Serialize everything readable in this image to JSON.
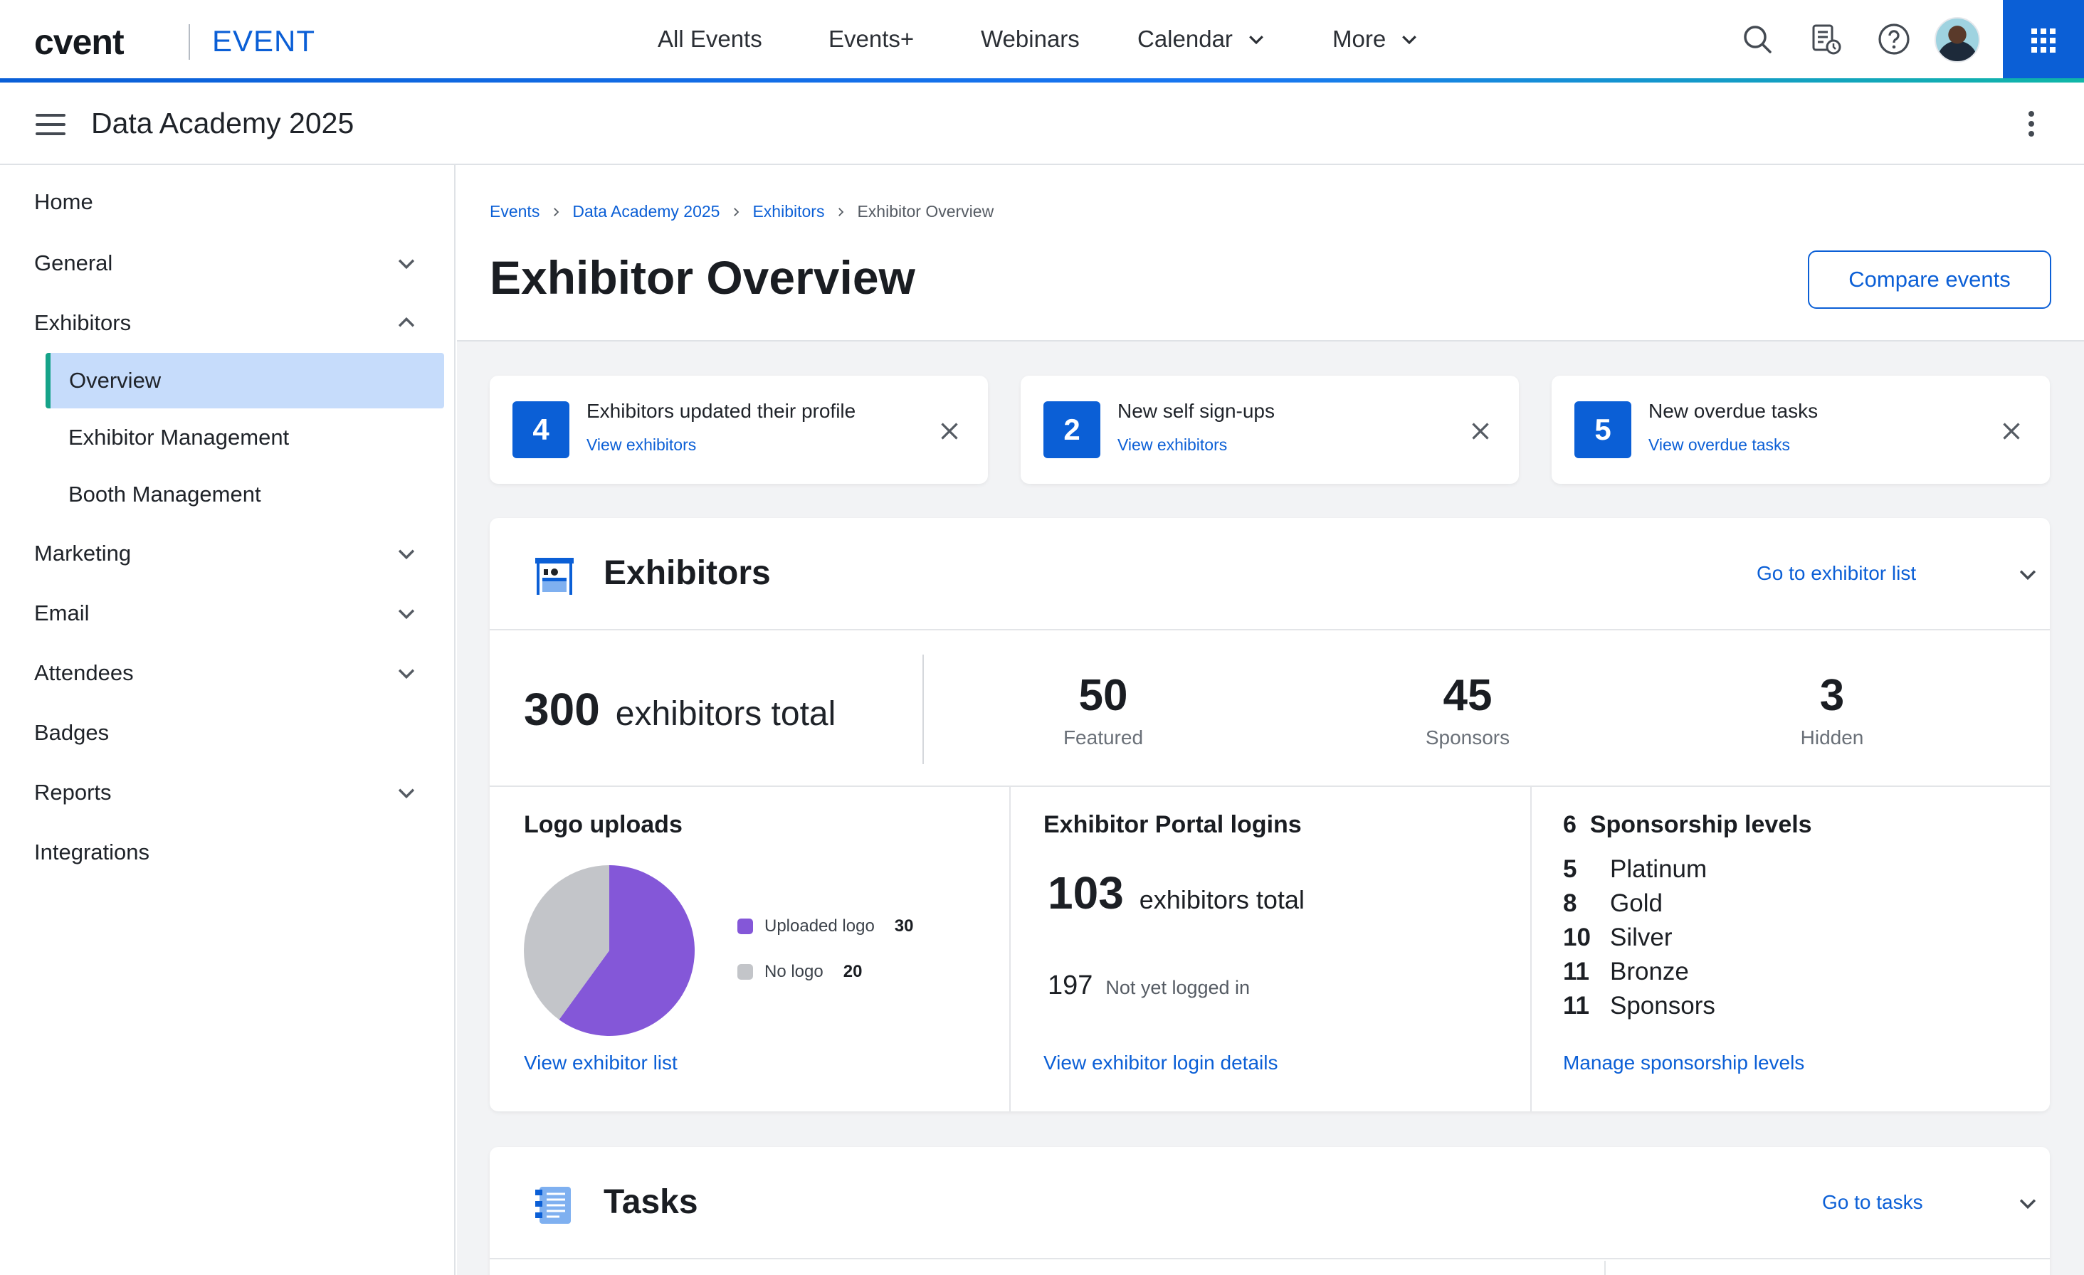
{
  "topbar": {
    "brand": "cvent",
    "product": "EVENT",
    "nav": [
      {
        "label": "All Events"
      },
      {
        "label": "Events+"
      },
      {
        "label": "Webinars"
      },
      {
        "label": "Calendar"
      },
      {
        "label": "More"
      }
    ]
  },
  "subheader": {
    "event_name": "Data Academy 2025"
  },
  "sidebar": {
    "items": [
      {
        "label": "Home"
      },
      {
        "label": "General"
      },
      {
        "label": "Exhibitors"
      },
      {
        "label": "Overview"
      },
      {
        "label": "Exhibitor Management"
      },
      {
        "label": "Booth Management"
      },
      {
        "label": "Marketing"
      },
      {
        "label": "Email"
      },
      {
        "label": "Attendees"
      },
      {
        "label": "Badges"
      },
      {
        "label": "Reports"
      },
      {
        "label": "Integrations"
      }
    ]
  },
  "breadcrumb": [
    "Events",
    "Data Academy 2025",
    "Exhibitors",
    "Exhibitor Overview"
  ],
  "page": {
    "title": "Exhibitor Overview",
    "compare_button": "Compare events"
  },
  "notices": [
    {
      "count": "4",
      "title": "Exhibitors updated their profile",
      "link": "View exhibitors"
    },
    {
      "count": "2",
      "title": "New self sign-ups",
      "link": "View exhibitors"
    },
    {
      "count": "5",
      "title": "New overdue tasks",
      "link": "View overdue tasks"
    }
  ],
  "exhibitors": {
    "title": "Exhibitors",
    "link": "Go to exhibitor list",
    "total": "300",
    "total_label": "exhibitors total",
    "stats": [
      {
        "value": "50",
        "label": "Featured"
      },
      {
        "value": "45",
        "label": "Sponsors"
      },
      {
        "value": "3",
        "label": "Hidden"
      }
    ],
    "logo_uploads": {
      "title": "Logo uploads",
      "legend": [
        {
          "label": "Uploaded logo",
          "value": "30",
          "color": "#8457d8"
        },
        {
          "label": "No logo",
          "value": "20",
          "color": "#c3c5c9"
        }
      ],
      "link": "View exhibitor list"
    },
    "portal_logins": {
      "title": "Exhibitor Portal logins",
      "total": "103",
      "total_label": "exhibitors total",
      "not_logged": "197",
      "not_logged_label": "Not yet logged in",
      "link": "View exhibitor login details"
    },
    "sponsorship": {
      "count": "6",
      "title": "Sponsorship levels",
      "levels": [
        {
          "count": "5",
          "name": "Platinum"
        },
        {
          "count": "8",
          "name": "Gold"
        },
        {
          "count": "10",
          "name": "Silver"
        },
        {
          "count": "11",
          "name": "Bronze"
        },
        {
          "count": "11",
          "name": "Sponsors"
        }
      ],
      "link": "Manage sponsorship levels"
    }
  },
  "tasks": {
    "title": "Tasks",
    "link": "Go to tasks"
  },
  "colors": {
    "accent": "#0b5fd6",
    "active_bg": "#c6dcfb",
    "active_bar": "#15a389"
  }
}
